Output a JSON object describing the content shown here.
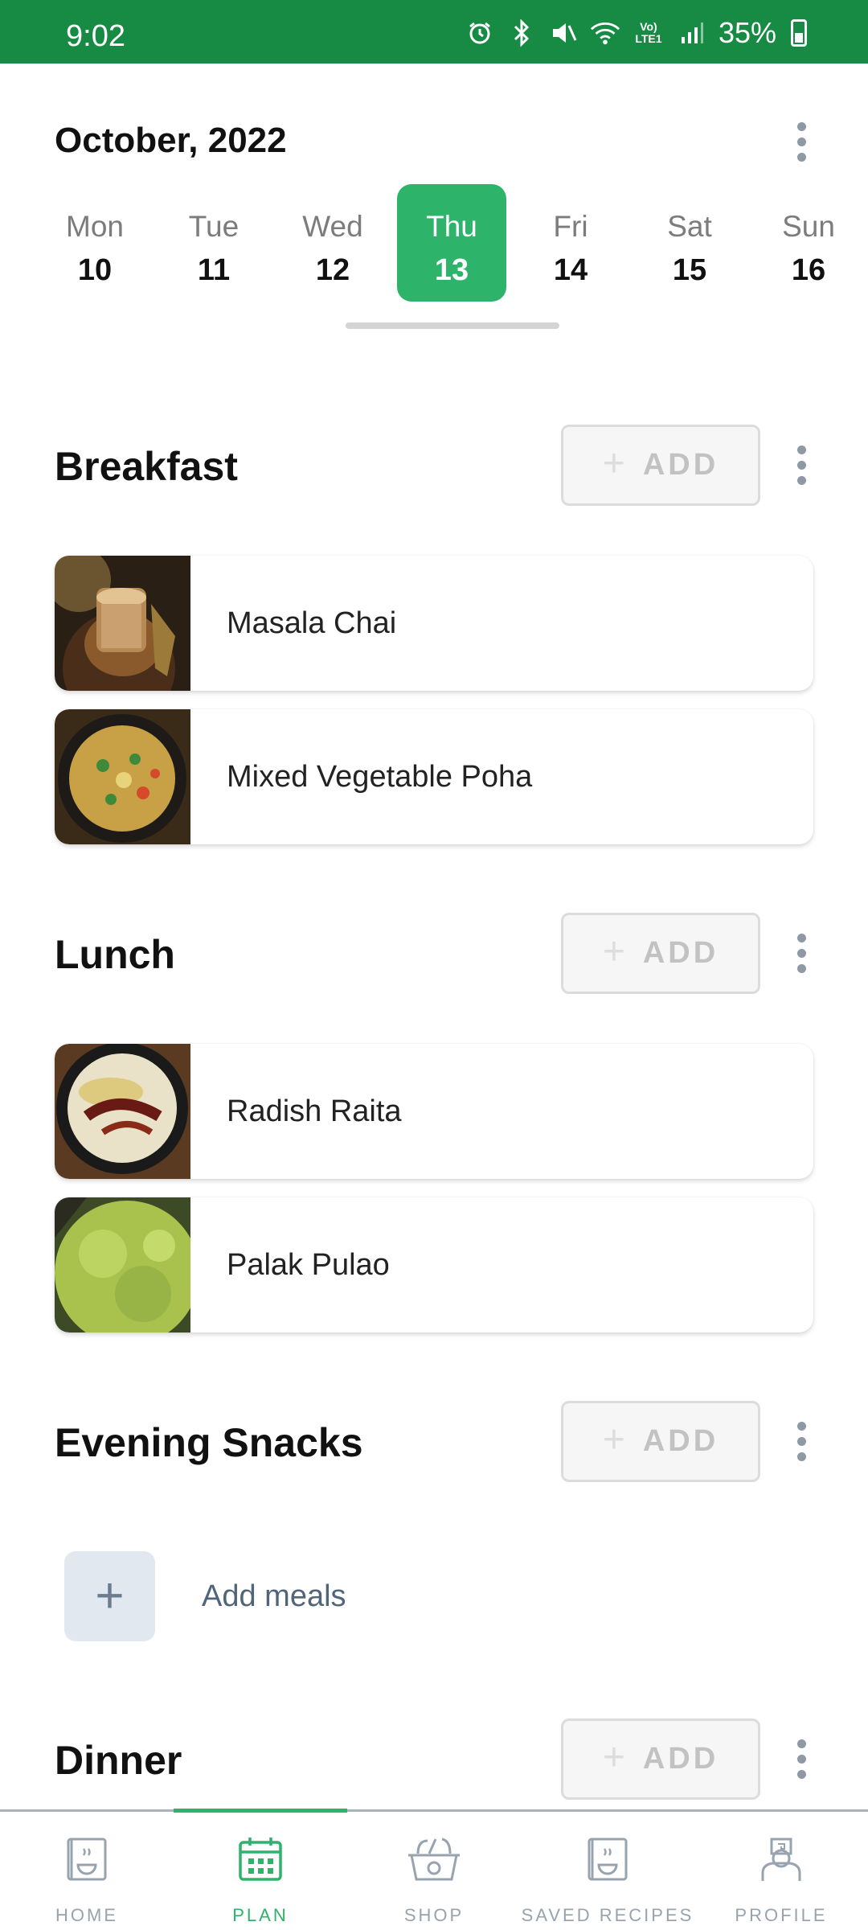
{
  "status_bar": {
    "time": "9:02",
    "icons": [
      "alarm-icon",
      "bluetooth-icon",
      "mute-icon",
      "wifi-icon",
      "volte-icon",
      "signal-icon"
    ],
    "battery": "35%"
  },
  "header": {
    "month": "October, 2022"
  },
  "week": {
    "days": [
      {
        "name": "Mon",
        "num": "10"
      },
      {
        "name": "Tue",
        "num": "11"
      },
      {
        "name": "Wed",
        "num": "12"
      },
      {
        "name": "Thu",
        "num": "13"
      },
      {
        "name": "Fri",
        "num": "14"
      },
      {
        "name": "Sat",
        "num": "15"
      },
      {
        "name": "Sun",
        "num": "16"
      }
    ],
    "selected": "Thu"
  },
  "sections": {
    "breakfast": {
      "title": "Breakfast",
      "add_label": "ADD",
      "meals": [
        {
          "name": "Masala Chai"
        },
        {
          "name": "Mixed Vegetable Poha"
        }
      ]
    },
    "lunch": {
      "title": "Lunch",
      "add_label": "ADD",
      "meals": [
        {
          "name": "Radish Raita"
        },
        {
          "name": "Palak Pulao"
        }
      ]
    },
    "evening_snacks": {
      "title": "Evening Snacks",
      "add_label": "ADD",
      "empty_label": "Add meals"
    },
    "dinner": {
      "title": "Dinner",
      "add_label": "ADD"
    }
  },
  "bottom_nav": {
    "items": [
      {
        "label": "HOME",
        "icon": "home-cookbook-icon"
      },
      {
        "label": "PLAN",
        "icon": "calendar-icon"
      },
      {
        "label": "SHOP",
        "icon": "basket-icon"
      },
      {
        "label": "SAVED RECIPES",
        "icon": "saved-recipes-icon"
      },
      {
        "label": "PROFILE",
        "icon": "chef-icon"
      }
    ],
    "active": "PLAN"
  },
  "colors": {
    "status_bar": "#178a43",
    "accent": "#2db36a",
    "muted": "#97a3af"
  }
}
